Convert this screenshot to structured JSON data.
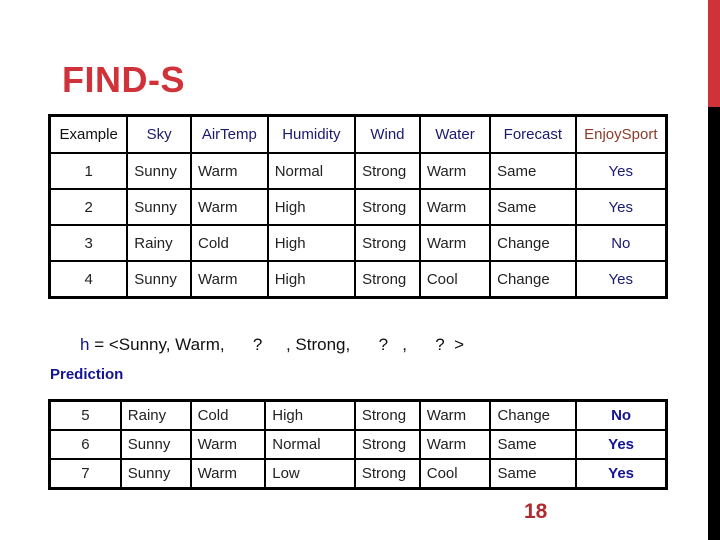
{
  "slide": {
    "title": "FIND-S",
    "page_number": "18",
    "accent_color": "#d0323a"
  },
  "training_table": {
    "headers": [
      "Example",
      "Sky",
      "AirTemp",
      "Humidity",
      "Wind",
      "Water",
      "Forecast",
      "EnjoySport"
    ],
    "rows": [
      [
        "1",
        "Sunny",
        "Warm",
        "Normal",
        "Strong",
        "Warm",
        "Same",
        "Yes"
      ],
      [
        "2",
        "Sunny",
        "Warm",
        "High",
        "Strong",
        "Warm",
        "Same",
        "Yes"
      ],
      [
        "3",
        "Rainy",
        "Cold",
        "High",
        "Strong",
        "Warm",
        "Change",
        "No"
      ],
      [
        "4",
        "Sunny",
        "Warm",
        "High",
        "Strong",
        "Cool",
        "Change",
        "Yes"
      ]
    ]
  },
  "hypothesis": {
    "label": "h",
    "text": " = <Sunny, Warm,      ?     , Strong,      ?   ,      ?  >"
  },
  "prediction": {
    "label": "Prediction",
    "rows": [
      [
        "5",
        "Rainy",
        "Cold",
        "High",
        "Strong",
        "Warm",
        "Change",
        "No"
      ],
      [
        "6",
        "Sunny",
        "Warm",
        "Normal",
        "Strong",
        "Warm",
        "Same",
        "Yes"
      ],
      [
        "7",
        "Sunny",
        "Warm",
        "Low",
        "Strong",
        "Cool",
        "Same",
        "Yes"
      ]
    ]
  }
}
